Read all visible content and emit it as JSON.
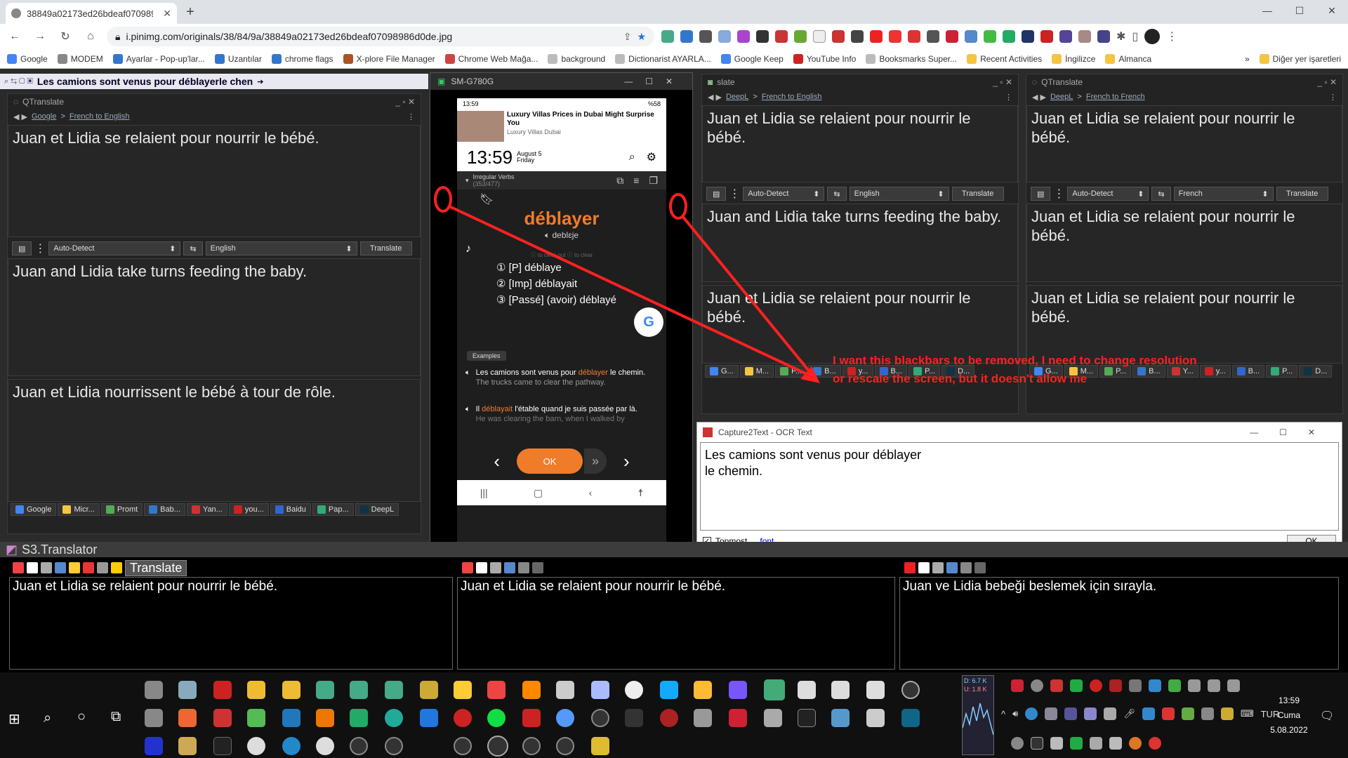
{
  "browser": {
    "tab_title": "38849a02173ed26bdeaf0709898",
    "url": "i.pinimg.com/originals/38/84/9a/38849a02173ed26bdeaf07098986d0de.jpg",
    "bookmarks": [
      "Google",
      "MODEM",
      "Ayarlar - Pop-up'lar...",
      "Uzantılar",
      "chrome flags",
      "X-plore File Manager",
      "Chrome Web Mağa...",
      "background",
      "Dictionarist AYARLA...",
      "Google Keep",
      "YouTube Info",
      "Booksmarks Super...",
      "Recent Activities",
      "İngilizce",
      "Almanca",
      "Diğer yer işaretleri"
    ]
  },
  "qt_left": {
    "toolbar_text": "Les camions sont venus pour déblayerle chen",
    "title": "QTranslate",
    "nav_service": "Google",
    "nav_pair": "French to English",
    "source": "Juan et Lidia se relaient pour nourrir le bébé.",
    "from_lang": "Auto-Detect",
    "to_lang": "English",
    "translate_label": "Translate",
    "result": "Juan and Lidia take turns feeding the baby.",
    "back": "Juan et Lidia nourrissent le bébé à tour de rôle.",
    "services": [
      "Google",
      "Micr...",
      "Promt",
      "Bab...",
      "Yan...",
      "you...",
      "Baidu",
      "Pap...",
      "DeepL"
    ]
  },
  "qt_mid": {
    "title": "slate",
    "nav_service": "DeepL",
    "nav_pair": "French to English",
    "source": "Juan et Lidia se relaient pour nourrir le bébé.",
    "from_lang": "Auto-Detect",
    "to_lang": "English",
    "translate_label": "Translate",
    "result": "Juan and Lidia take turns feeding the baby.",
    "back": "Juan et Lidia se relaient pour nourrir le bébé.",
    "services": [
      "G...",
      "M...",
      "P...",
      "B...",
      "y...",
      "B...",
      "P...",
      "D..."
    ]
  },
  "qt_right": {
    "title": "QTranslate",
    "nav_service": "DeepL",
    "nav_pair": "French to French",
    "source": "Juan et Lidia se relaient pour nourrir le bébé.",
    "from_lang": "Auto-Detect",
    "to_lang": "French",
    "translate_label": "Translate",
    "result": "Juan et Lidia se relaient pour nourrir le bébé.",
    "back": "Juan et Lidia se relaient pour nourrir le bébé.",
    "services": [
      "G...",
      "M...",
      "P...",
      "B...",
      "Y...",
      "y...",
      "B...",
      "P...",
      "D..."
    ]
  },
  "phone": {
    "window_title": "SM-G780G",
    "status_time": "13:59",
    "battery": "%58",
    "ad_title": "Luxury Villas Prices in Dubai Might Surprise You",
    "ad_source": "Luxury Villas Dubai",
    "clock": "13:59",
    "date_line1": "August 5",
    "date_line2": "Friday",
    "deck": "Irregular Verbs",
    "deck_count": "(353/477)",
    "word": "déblayer",
    "pron": "deblɛje",
    "hint": "ⓘ to clear out ⓘ to clear",
    "forms": [
      "① [P] déblaye",
      "② [Imp] déblayait",
      "③ [Passé] (avoir) déblayé"
    ],
    "examples_label": "Examples",
    "ex1_pre": "Les camions sont venus pour ",
    "ex1_word": "déblayer",
    "ex1_post": " le chemin.",
    "ex1_tr": "The trucks came to clear the pathway.",
    "ex2_pre": "Il ",
    "ex2_word": "déblayait",
    "ex2_post": " l'étable quand je suis passée par là.",
    "ex2_tr": "He was clearing the barn, when I walked by",
    "ok_label": "OK"
  },
  "annotation": {
    "line1": "I want this blackbars to be removed, I need to change resolution",
    "line2": "or rescale the screen, but it doesn't allow me"
  },
  "capture": {
    "title": "Capture2Text - OCR Text",
    "line1": "Les camions sont venus pour déblayer",
    "line2": "le chemin.",
    "topmost": "Topmost",
    "font": "font",
    "ok": "OK"
  },
  "s3": {
    "title": "S3.Translator",
    "translate": "Translate",
    "box1": "Juan et Lidia se relaient pour nourrir le bébé.",
    "box2": "Juan et Lidia se relaient pour nourrir le bébé.",
    "box3": "Juan ve Lidia bebeği beslemek için sırayla."
  },
  "tray": {
    "net1": "D: 6.7 K",
    "net2": "U: 1.8 K",
    "lang": "TUR",
    "time": "13:59",
    "day": "Cuma",
    "date": "5.08.2022"
  },
  "colors": {
    "accent_orange": "#f07c2a",
    "annotation_red": "#ff2020"
  }
}
